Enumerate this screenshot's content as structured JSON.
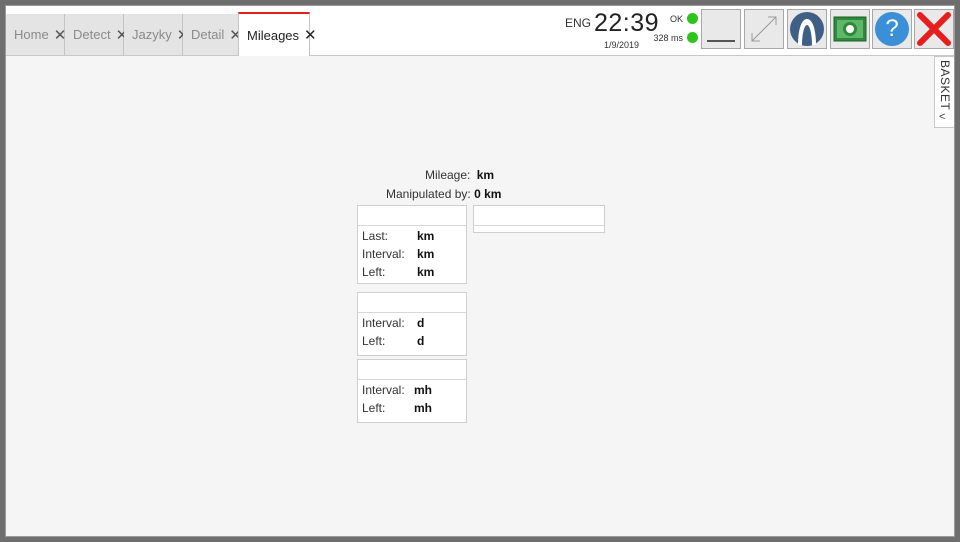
{
  "tabs": [
    {
      "label": "Home"
    },
    {
      "label": "Detect"
    },
    {
      "label": "Jazyky"
    },
    {
      "label": "Detail"
    },
    {
      "label": "Mileages"
    }
  ],
  "header": {
    "language": "ENG",
    "time": "22:39",
    "date": "1/9/2019",
    "status_ok": "OK",
    "latency": "328 ms"
  },
  "toolbar": {
    "minimize_icon": "minimize-icon",
    "resize_icon": "resize-arrows-icon",
    "user_icon": "user-icon",
    "money_icon": "banknote-icon",
    "help_label": "?",
    "close_icon": "close-x-icon"
  },
  "basket": {
    "label": "BASKET"
  },
  "mileage": {
    "label": "Mileage:",
    "value": "km",
    "manipulated_label": "Manipulated by:",
    "manipulated_value": "0 km"
  },
  "cards": {
    "km_card": {
      "rows": [
        {
          "label": "Last:",
          "value": "km"
        },
        {
          "label": "Interval:",
          "value": "km"
        },
        {
          "label": "Left:",
          "value": "km"
        }
      ]
    },
    "days_card": {
      "rows": [
        {
          "label": "Interval:",
          "value": "d"
        },
        {
          "label": "Left:",
          "value": "d"
        }
      ]
    },
    "mh_card": {
      "rows": [
        {
          "label": "Interval:",
          "value": "mh"
        },
        {
          "label": "Left:",
          "value": "mh"
        }
      ]
    }
  },
  "colors": {
    "status_green": "#2ec41f",
    "active_tab_accent": "#e02020",
    "help_blue": "#3a8fd6",
    "close_red": "#e81e1e",
    "user_blue": "#3f5f85"
  }
}
